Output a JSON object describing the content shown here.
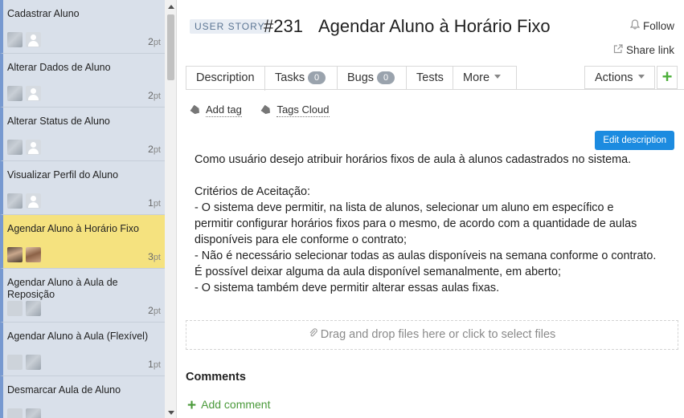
{
  "list": {
    "items": [
      {
        "title": "Cadastrar Aluno",
        "points": "2",
        "unit": "pt",
        "active": false
      },
      {
        "title": "Alterar Dados de Aluno",
        "points": "2",
        "unit": "pt",
        "active": false
      },
      {
        "title": "Alterar Status de Aluno",
        "points": "2",
        "unit": "pt",
        "active": false
      },
      {
        "title": "Visualizar Perfil do Aluno",
        "points": "1",
        "unit": "pt",
        "active": false
      },
      {
        "title": "Agendar Aluno à Horário Fixo",
        "points": "3",
        "unit": "pt",
        "active": true
      },
      {
        "title": "Agendar Aluno à Aula de Reposição",
        "points": "2",
        "unit": "pt",
        "active": false
      },
      {
        "title": "Agendar Aluno à Aula (Flexível)",
        "points": "1",
        "unit": "pt",
        "active": false
      },
      {
        "title": "Desmarcar Aula de Aluno",
        "points": "",
        "unit": "",
        "active": false
      }
    ]
  },
  "entity": {
    "type": "USER STORY",
    "id": "#231",
    "name": "Agendar Aluno à Horário Fixo"
  },
  "header": {
    "follow": "Follow",
    "share": "Share link"
  },
  "tabs": [
    {
      "label": "Description"
    },
    {
      "label": "Tasks",
      "count": "0"
    },
    {
      "label": "Bugs",
      "count": "0"
    },
    {
      "label": "Tests"
    },
    {
      "label": "More"
    }
  ],
  "actions": {
    "label": "Actions",
    "add": "+"
  },
  "tags": {
    "add": "Add tag",
    "cloud": "Tags Cloud"
  },
  "edit_button": "Edit description",
  "description": {
    "lines": [
      "Como usuário desejo atribuir horários fixos de aula à alunos cadastrados no sistema.",
      "",
      "Critérios de Aceitação:",
      "- O sistema deve permitir, na lista de alunos, selecionar um aluno em específico e",
      "permitir configurar horários fixos para o mesmo, de acordo com a quantidade de aulas",
      "disponíveis para ele conforme o contrato;",
      "- Não é necessário selecionar todas as aulas disponíveis na semana conforme o contrato.",
      "É possível deixar alguma da aula disponível semanalmente, em aberto;",
      "- O sistema também deve permitir alterar essas aulas fixas."
    ]
  },
  "dropzone": "Drag and drop files here or click to select files",
  "comments": {
    "heading": "Comments",
    "add": "Add comment"
  },
  "colors": {
    "accent": "#1c8be0",
    "active_card": "#f5e27f",
    "card": "#d9e0ea",
    "green": "#4caf3a"
  }
}
